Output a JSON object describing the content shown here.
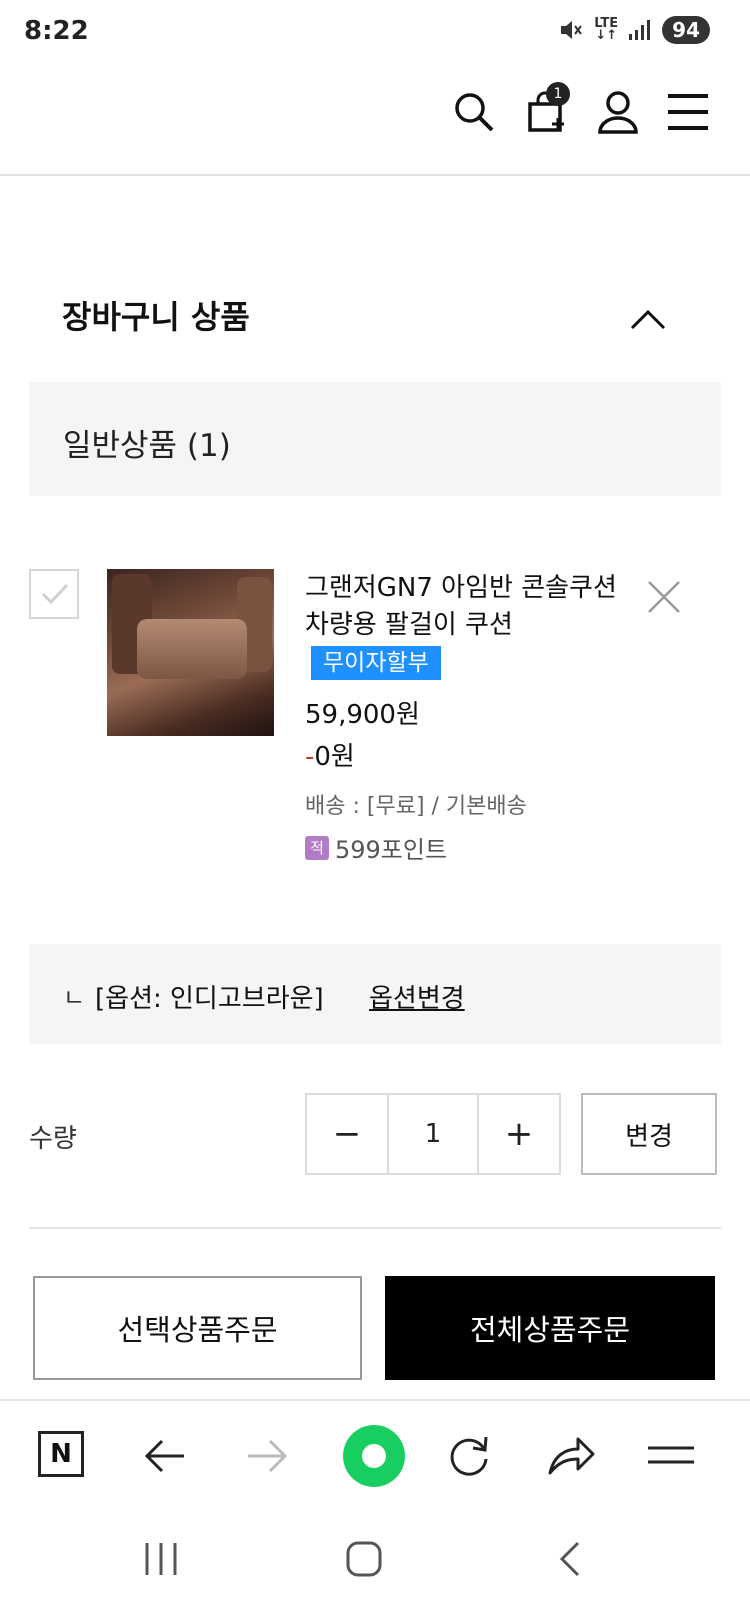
{
  "status_bar": {
    "time": "8:22",
    "network": "LTE",
    "battery": "94"
  },
  "header": {
    "cart_count": "1"
  },
  "cart": {
    "title": "장바구니 상품",
    "group_label": "일반상품 (1)",
    "item": {
      "name": "그랜저GN7 아임반 콘솔쿠션 차량용 팔걸이 쿠션",
      "badge": "무이자할부",
      "price": "59,900원",
      "discount_sign": "-",
      "discount_value": "0원",
      "shipping": "배송 : [무료] / 기본배송",
      "points_icon": "적",
      "points": "599포인트",
      "option_arrow": "ㄴ",
      "option": "[옵션: 인디고브라운]",
      "option_change": "옵션변경"
    },
    "quantity": {
      "label": "수량",
      "minus": "−",
      "value": "1",
      "plus": "+",
      "change_label": "변경"
    },
    "buttons": {
      "order_selected": "선택상품주문",
      "order_all": "전체상품주문"
    }
  },
  "browser_bar": {
    "home_icon": "N"
  },
  "colors": {
    "accent_badge": "#1e90ff",
    "discount_sign": "#c0392b",
    "browser_green": "#19ce60",
    "primary_button": "#000000"
  }
}
